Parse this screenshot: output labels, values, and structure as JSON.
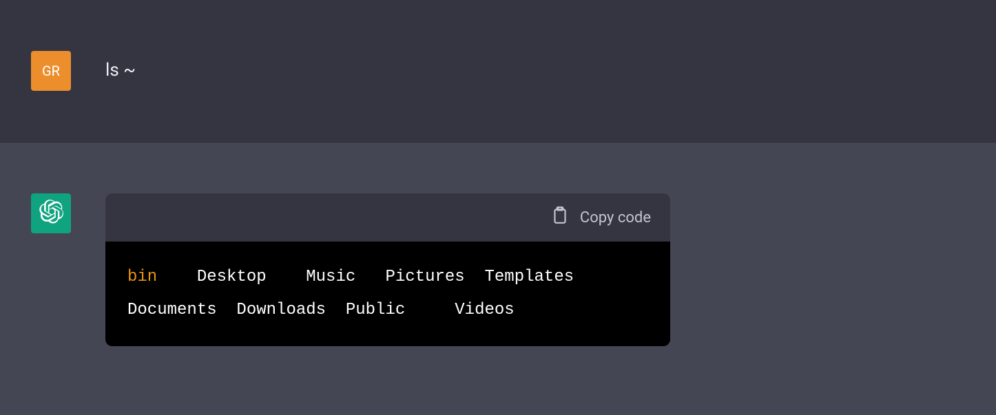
{
  "user": {
    "avatar_initials": "GR",
    "message": "ls ~"
  },
  "assistant": {
    "copy_label": "Copy code",
    "code": {
      "line1": {
        "highlighted": "bin",
        "rest": "    Desktop    Music   Pictures  Templates"
      },
      "line2": "Documents  Downloads  Public     Videos"
    }
  }
}
